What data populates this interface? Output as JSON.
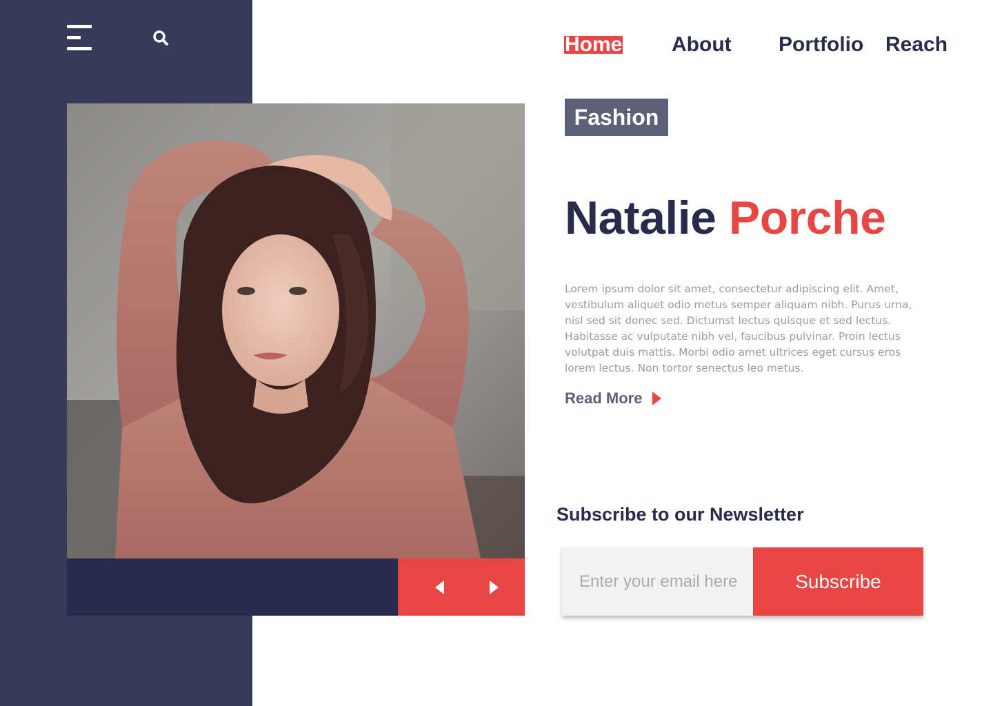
{
  "nav": {
    "items": [
      {
        "label": "Home",
        "active": true
      },
      {
        "label": "About",
        "active": false
      },
      {
        "label": "Portfolio",
        "active": false
      },
      {
        "label": "Reach",
        "active": false
      }
    ]
  },
  "header_icons": [
    "menu-icon",
    "search-icon"
  ],
  "hero": {
    "badge": "Fashion",
    "first_name": "Natalie",
    "last_name": "Porche",
    "description": "Lorem ipsum dolor sit amet, consectetur adipiscing elit. Amet, vestibulum aliquet odio metus semper aliquam nibh. Purus urna, nisl sed sit donec sed. Dictumst lectus quisque et sed lectus. Habitasse ac vulputate nibh vel, faucibus pulvinar. Proin lectus volutpat duis mattis. Morbi odio amet ultrices eget cursus eros lorem lectus. Non tortor senectus leo metus.",
    "read_more": "Read More"
  },
  "slider": {
    "prev_icon": "arrow-left-icon",
    "next_icon": "arrow-right-icon"
  },
  "newsletter": {
    "title": "Subscribe to our Newsletter",
    "placeholder": "Enter your email here",
    "value": "",
    "button_label": "Subscribe"
  },
  "colors": {
    "sidebar": "#383a5a",
    "navy": "#282b4b",
    "accent": "#e84545",
    "badge": "#5e6078",
    "muted_text": "#9a9aa8",
    "input_bg": "#f3f2f3"
  }
}
